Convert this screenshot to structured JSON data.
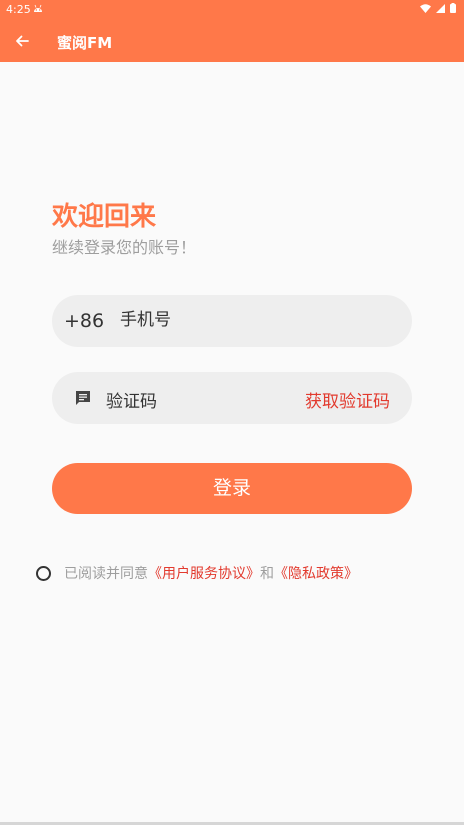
{
  "status_bar": {
    "time": "4:25"
  },
  "app_bar": {
    "title": "蜜阅FM"
  },
  "welcome": {
    "title": "欢迎回来",
    "subtitle": "继续登录您的账号！"
  },
  "phone": {
    "prefix": "+86",
    "placeholder": "手机号"
  },
  "code": {
    "placeholder": "验证码",
    "get_code": "获取验证码"
  },
  "login_button": "登录",
  "agreement": {
    "prefix": "已阅读并同意",
    "user_agreement": "《用户服务协议》",
    "and": "和",
    "privacy_policy": "《隐私政策》"
  },
  "colors": {
    "accent": "#ff7849",
    "link": "#e23a2e",
    "muted": "#9e9e9e",
    "field_bg": "#eeeeee"
  },
  "icons": [
    "android-icon",
    "wifi-icon",
    "signal-icon",
    "battery-icon",
    "back-arrow-icon",
    "message-icon"
  ]
}
